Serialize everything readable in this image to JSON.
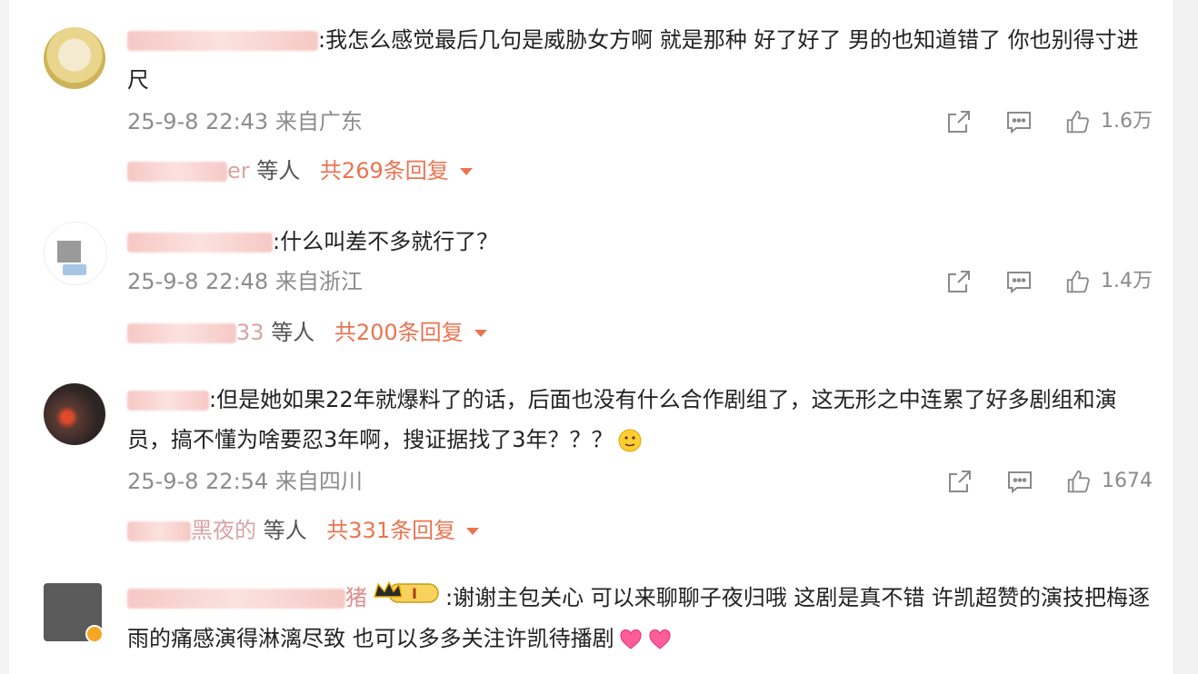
{
  "comments": [
    {
      "text": ":我怎么感觉最后几句是威胁女方啊  就是那种  好了好了  男的也知道错了  你也别得寸进尺",
      "time": "25-9-8 22:43",
      "location": "来自广东",
      "likes": "1.6万",
      "replies_who": "等人",
      "replies_who_partial": "er",
      "replies_count": "共269条回复"
    },
    {
      "text": ":什么叫差不多就行了？",
      "time": "25-9-8 22:48",
      "location": "来自浙江",
      "likes": "1.4万",
      "replies_who": "等人",
      "replies_who_partial": "33",
      "replies_count": "共200条回复"
    },
    {
      "text": ":但是她如果22年就爆料了的话，后面也没有什么合作剧组了，这无形之中连累了好多剧组和演员，搞不懂为啥要忍3年啊，搜证据找了3年？？？",
      "time": "25-9-8 22:54",
      "location": "来自四川",
      "likes": "1674",
      "replies_who": "等人",
      "replies_who_partial": "黑夜的",
      "replies_count": "共331条回复"
    },
    {
      "text": ":谢谢主包关心 可以来聊聊子夜归哦 这剧是真不错 许凯超赞的演技把梅逐雨的痛感演得淋漓尽致 也可以多多关注许凯待播剧",
      "name_partial": "猪",
      "badge_text": "I"
    }
  ],
  "icons": [
    "share-icon",
    "comment-icon",
    "like-icon",
    "caret-down-icon",
    "crown-badge-icon",
    "emoji-icon",
    "heart-emoji-icon"
  ],
  "colors": {
    "accent": "#eb7350",
    "meta": "#8c8c8c",
    "text": "#222222"
  }
}
